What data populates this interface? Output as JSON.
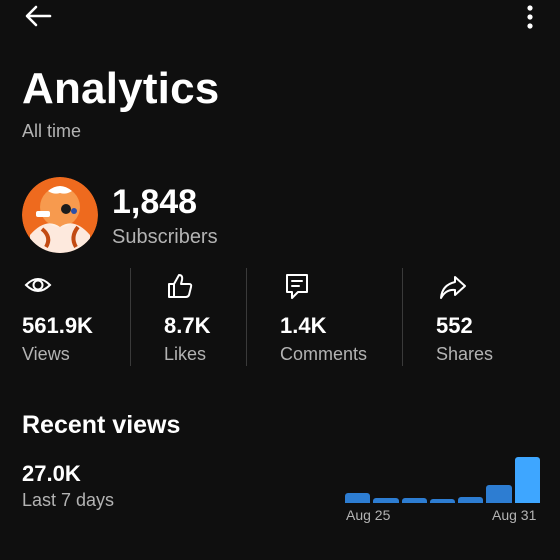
{
  "header": {
    "back_icon": "arrow-left-icon",
    "menu_icon": "more-vertical-icon"
  },
  "page": {
    "title": "Analytics",
    "subtitle": "All time"
  },
  "channel": {
    "subscribers_count": "1,848",
    "subscribers_label": "Subscribers"
  },
  "stats": [
    {
      "icon": "eye-icon",
      "value": "561.9K",
      "label": "Views"
    },
    {
      "icon": "thumbs-up-icon",
      "value": "8.7K",
      "label": "Likes"
    },
    {
      "icon": "comment-icon",
      "value": "1.4K",
      "label": "Comments"
    },
    {
      "icon": "share-icon",
      "value": "552",
      "label": "Shares"
    }
  ],
  "recent": {
    "title": "Recent views",
    "value": "27.0K",
    "period": "Last 7 days",
    "colors": {
      "normal": "#2d7dd2",
      "highlight": "#3ea6ff"
    }
  },
  "chart_data": {
    "type": "bar",
    "categories": [
      "",
      "",
      "",
      "",
      "",
      "",
      ""
    ],
    "values": [
      10,
      5,
      5,
      4,
      6,
      18,
      45
    ],
    "tick_labels": [
      "Aug 25",
      "Aug 31"
    ],
    "highlight_index": 6,
    "title": "",
    "xlabel": "",
    "ylabel": ""
  }
}
